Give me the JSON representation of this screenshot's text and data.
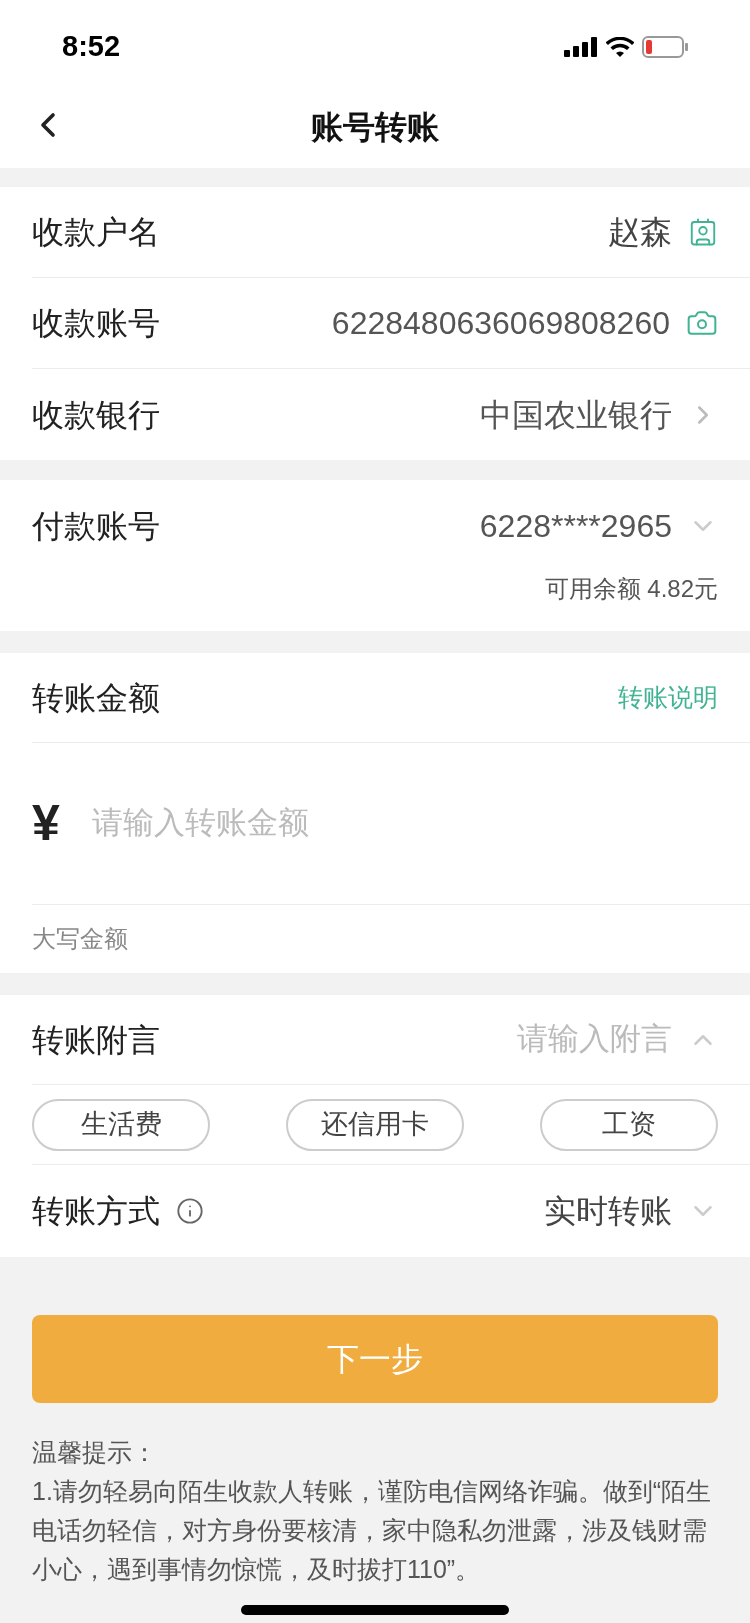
{
  "status_bar": {
    "time": "8:52"
  },
  "nav": {
    "title": "账号转账"
  },
  "payee": {
    "name_label": "收款户名",
    "name_value": "赵森",
    "account_label": "收款账号",
    "account_value": "6228480636069808260",
    "bank_label": "收款银行",
    "bank_value": "中国农业银行"
  },
  "payer": {
    "label": "付款账号",
    "value": "6228****2965",
    "balance": "可用余额 4.82元"
  },
  "amount": {
    "label": "转账金额",
    "link": "转账说明",
    "currency": "¥",
    "placeholder": "请输入转账金额",
    "uppercase_label": "大写金额"
  },
  "note": {
    "label": "转账附言",
    "placeholder": "请输入附言",
    "expanded": true,
    "tags": [
      {
        "label": "生活费"
      },
      {
        "label": "还信用卡"
      },
      {
        "label": "工资"
      }
    ]
  },
  "method": {
    "label": "转账方式",
    "value": "实时转账"
  },
  "next_button": "下一步",
  "tips": {
    "title": "温馨提示：",
    "lines": [
      "1.请勿轻易向陌生收款人转账，谨防电信网络诈骗。做到“陌生电话勿轻信，对方身份要核清，家中隐私勿泄露，涉及钱财需小心，遇到事情勿惊慌，及时拔打110”。"
    ]
  }
}
